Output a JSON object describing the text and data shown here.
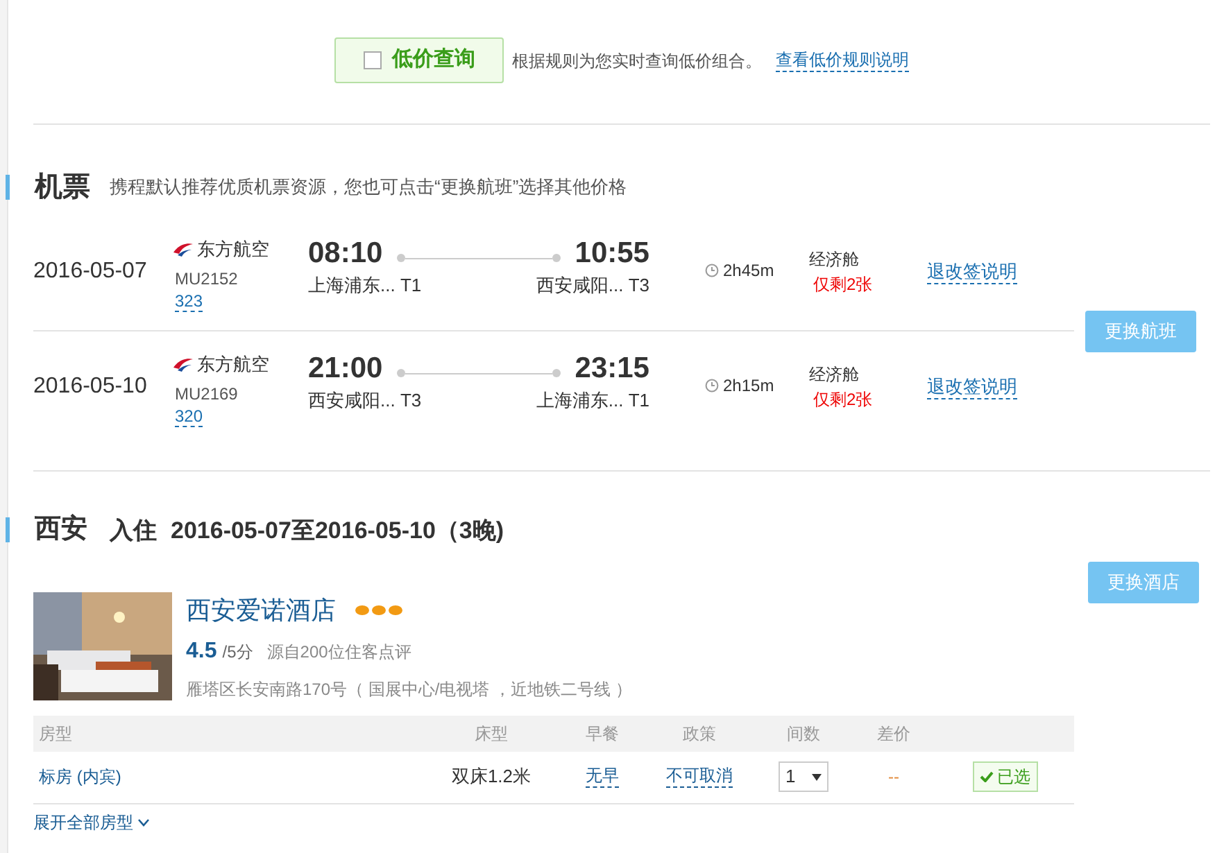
{
  "low_price": {
    "label": "低价查询",
    "checked": false,
    "note": "根据规则为您实时查询低价组合。",
    "link": "查看低价规则说明"
  },
  "flights": {
    "title": "机票",
    "subtitle": "携程默认推荐优质机票资源，您也可点击“更换航班”选择其他价格",
    "change_button": "更换航班",
    "rows": [
      {
        "date": "2016-05-07",
        "airline": "东方航空",
        "flight_no": "MU2152",
        "aircraft": "323",
        "dep_time": "08:10",
        "dep_airport": "上海浦东... T1",
        "arr_time": "10:55",
        "arr_airport": "西安咸阳... T3",
        "duration": "2h45m",
        "cabin": "经济舱",
        "remaining": "仅剩2张",
        "rules": "退改签说明"
      },
      {
        "date": "2016-05-10",
        "airline": "东方航空",
        "flight_no": "MU2169",
        "aircraft": "320",
        "dep_time": "21:00",
        "dep_airport": "西安咸阳... T3",
        "arr_time": "23:15",
        "arr_airport": "上海浦东... T1",
        "duration": "2h15m",
        "cabin": "经济舱",
        "remaining": "仅剩2张",
        "rules": "退改签说明"
      }
    ]
  },
  "hotel": {
    "city": "西安",
    "checkin_label": "入住",
    "dates": "2016-05-07至2016-05-10（3晚)",
    "change_button": "更换酒店",
    "name": "西安爱诺酒店",
    "score": "4.5",
    "score_max": "/5分",
    "reviews": "源自200位住客点评",
    "address": "雁塔区长安南路170号（ 国展中心/电视塔 ，近地铁二号线 ）",
    "columns": [
      "房型",
      "床型",
      "早餐",
      "政策",
      "间数",
      "差价"
    ],
    "rooms": [
      {
        "type": "标房 (内宾)",
        "bed": "双床1.2米",
        "breakfast": "无早",
        "policy": "不可取消",
        "count": "1",
        "diff": "--",
        "action": "已选",
        "selected": true
      }
    ],
    "expand": "展开全部房型"
  }
}
